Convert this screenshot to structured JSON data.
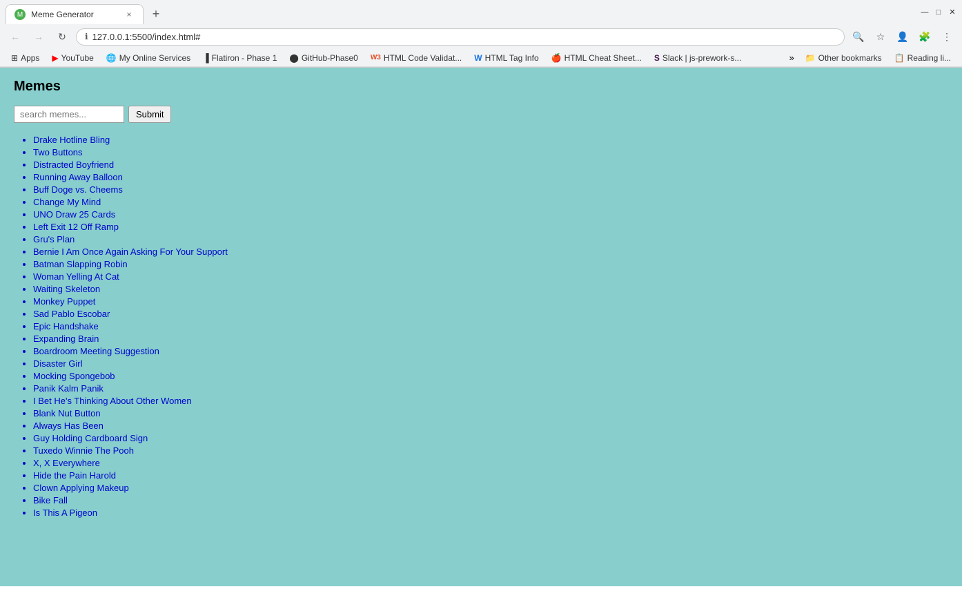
{
  "browser": {
    "tab": {
      "title": "Meme Generator",
      "close": "×"
    },
    "new_tab": "+",
    "window_controls": {
      "minimize": "—",
      "maximize": "□",
      "close": ""
    },
    "address": "127.0.0.1:5500/index.html#",
    "nav": {
      "back": "←",
      "forward": "→",
      "refresh": "↻"
    }
  },
  "bookmarks": [
    {
      "id": "apps",
      "label": "Apps",
      "icon": "⊞",
      "type": "apps"
    },
    {
      "id": "youtube",
      "label": "YouTube",
      "icon": "▶",
      "type": "yt"
    },
    {
      "id": "my-online-services",
      "label": "My Online Services",
      "icon": "🌐",
      "type": "globe"
    },
    {
      "id": "flatiron",
      "label": "Flatiron - Phase 1",
      "icon": "▐",
      "type": "flatiron"
    },
    {
      "id": "github-phase0",
      "label": "GitHub-Phase0",
      "icon": "●",
      "type": "gh"
    },
    {
      "id": "html-validate",
      "label": "HTML Code Validat...",
      "icon": "W3",
      "type": "w3"
    },
    {
      "id": "html-tag-info",
      "label": "HTML Tag Info",
      "icon": "W",
      "type": "tag"
    },
    {
      "id": "html-cheat-sheet",
      "label": "HTML Cheat Sheet...",
      "icon": "🍎",
      "type": "html"
    },
    {
      "id": "slack",
      "label": "Slack | js-prework-s...",
      "icon": "S",
      "type": "slack"
    }
  ],
  "bookmarks_more": "»",
  "bookmarks_right": [
    {
      "id": "other-bookmarks",
      "label": "Other bookmarks"
    },
    {
      "id": "reading-list",
      "label": "Reading li..."
    }
  ],
  "page": {
    "title": "Memes",
    "search_placeholder": "search memes...",
    "submit_label": "Submit"
  },
  "meme_list": [
    "Drake Hotline Bling",
    "Two Buttons",
    "Distracted Boyfriend",
    "Running Away Balloon",
    "Buff Doge vs. Cheems",
    "Change My Mind",
    "UNO Draw 25 Cards",
    "Left Exit 12 Off Ramp",
    "Gru's Plan",
    "Bernie I Am Once Again Asking For Your Support",
    "Batman Slapping Robin",
    "Woman Yelling At Cat",
    "Waiting Skeleton",
    "Monkey Puppet",
    "Sad Pablo Escobar",
    "Epic Handshake",
    "Expanding Brain",
    "Boardroom Meeting Suggestion",
    "Disaster Girl",
    "Mocking Spongebob",
    "Panik Kalm Panik",
    "I Bet He's Thinking About Other Women",
    "Blank Nut Button",
    "Always Has Been",
    "Guy Holding Cardboard Sign",
    "Tuxedo Winnie The Pooh",
    "X, X Everywhere",
    "Hide the Pain Harold",
    "Clown Applying Makeup",
    "Bike Fall",
    "Is This A Pigeon"
  ]
}
